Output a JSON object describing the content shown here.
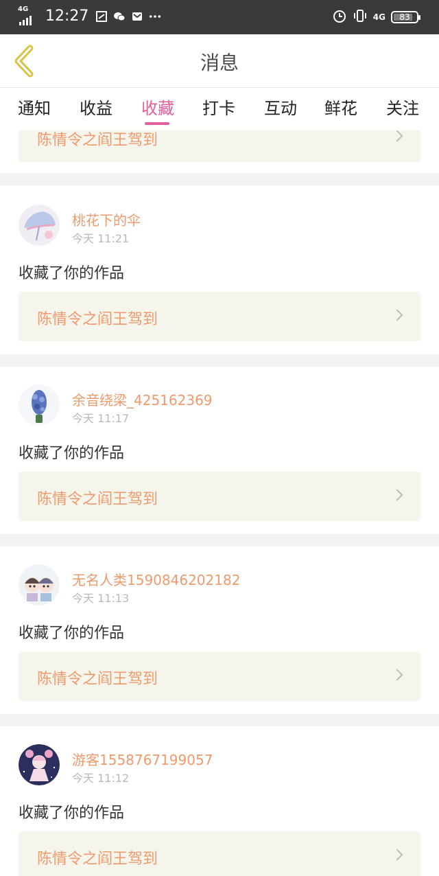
{
  "status_bar": {
    "network": "4G",
    "time": "12:27",
    "right_network": "4G",
    "battery": "83",
    "battery_level": 0.83
  },
  "header": {
    "title": "消息"
  },
  "tabs": [
    {
      "label": "通知"
    },
    {
      "label": "收益"
    },
    {
      "label": "收藏",
      "active": true
    },
    {
      "label": "打卡"
    },
    {
      "label": "互动"
    },
    {
      "label": "鲜花"
    },
    {
      "label": "关注"
    }
  ],
  "colors": {
    "accent": "#e0609a",
    "username": "#ef9a6d",
    "work_bg": "#f6f5ec"
  },
  "top_partial": {
    "work_title": "陈情令之阎王驾到"
  },
  "notifications": [
    {
      "username": "桃花下的伞",
      "time": "今天 11:21",
      "action": "收藏了你的作品",
      "work_title": "陈情令之阎王驾到"
    },
    {
      "username": "余音绕梁_425162369",
      "time": "今天 11:17",
      "action": "收藏了你的作品",
      "work_title": "陈情令之阎王驾到"
    },
    {
      "username": "无名人类1590846202182",
      "time": "今天 11:13",
      "action": "收藏了你的作品",
      "work_title": "陈情令之阎王驾到"
    },
    {
      "username": "游客1558767199057",
      "time": "今天 11:12",
      "action": "收藏了你的作品",
      "work_title": "陈情令之阎王驾到"
    }
  ]
}
